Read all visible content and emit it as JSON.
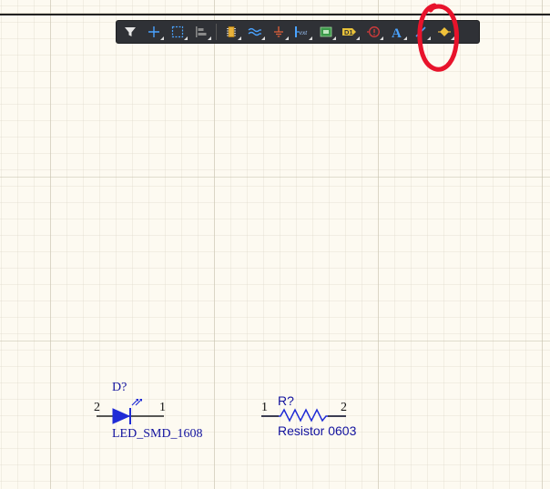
{
  "toolbar": {
    "items": [
      {
        "icon": "filter-icon",
        "label": "Filter"
      },
      {
        "icon": "crosshair-icon",
        "label": "Move"
      },
      {
        "icon": "select-rect-icon",
        "label": "Select"
      },
      {
        "icon": "align-icon",
        "label": "Align"
      },
      {
        "icon": "component-icon",
        "label": "Place Part"
      },
      {
        "icon": "wire-icon",
        "label": "Wire"
      },
      {
        "icon": "ground-icon",
        "label": "Power Port"
      },
      {
        "icon": "port-icon",
        "label": "Port"
      },
      {
        "icon": "harness-icon",
        "label": "Sheet Symbol"
      },
      {
        "icon": "designator-icon",
        "label": "D1"
      },
      {
        "icon": "directive-icon",
        "label": "Directive"
      },
      {
        "icon": "text-icon",
        "label": "A"
      },
      {
        "icon": "line-icon",
        "label": "Line"
      },
      {
        "icon": "shape-icon",
        "label": "Shapes"
      }
    ],
    "highlighted_item": "line-icon"
  },
  "annotation": {
    "color": "#e8132b",
    "shape": "hand-drawn-circle",
    "target": "line-icon"
  },
  "parts": {
    "led": {
      "designator": "D?",
      "comment": "LED_SMD_1608",
      "pin_left": "2",
      "pin_right": "1"
    },
    "resistor": {
      "designator": "R?",
      "comment": "Resistor 0603",
      "pin_left": "1",
      "pin_right": "2"
    }
  },
  "colors": {
    "sheet_bg": "#fdfaf1",
    "part_blue": "#12129e",
    "toolbar_bg": "#2f3136",
    "annotation_red": "#e8132b"
  }
}
